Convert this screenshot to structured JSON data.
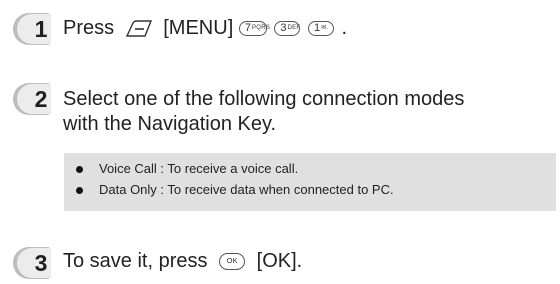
{
  "steps": [
    {
      "number": "1",
      "prefix": "Press",
      "menu_label": "[MENU]",
      "suffix": "."
    },
    {
      "number": "2",
      "line1": "Select one of the following connection modes",
      "line2": "with the Navigation Key."
    },
    {
      "number": "3",
      "prefix": "To save it, press",
      "ok_key": "OK",
      "ok_label": "[OK]."
    }
  ],
  "keys": [
    {
      "digit": "7",
      "letters": "PQRS"
    },
    {
      "digit": "3",
      "letters": "DEF"
    },
    {
      "digit": "1",
      "letters": "✉."
    }
  ],
  "note": {
    "items": [
      "Voice Call : To receive a voice call.",
      "Data Only : To receive data when connected to PC."
    ]
  },
  "icons": {
    "menu": "menu-softkey-icon",
    "bullet": "bullet-icon"
  },
  "colors": {
    "badge_shadow": "#bdbdbd",
    "badge_fill": "#ececec",
    "note_bg": "#e0e0e0"
  }
}
